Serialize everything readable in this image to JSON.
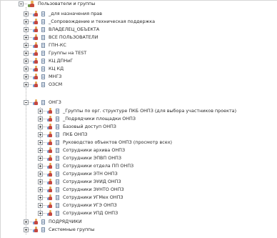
{
  "tree": {
    "root": {
      "label": "Пользователи и группы",
      "icon": "users-group-icon"
    },
    "groups": [
      {
        "label": "_для назначения прав"
      },
      {
        "label": "_Сопровождение и техническая поддержка"
      },
      {
        "label": "ВЛАДЕЛЕЦ_ОБЪЕКТА"
      },
      {
        "label": "ВСЕ ПОЛЬЗОВАТЕЛИ"
      },
      {
        "label": "ГПН-КС"
      },
      {
        "label": "Группы на TEST"
      },
      {
        "label": "КЦ ДПНиГ"
      },
      {
        "label": "КЦ КД"
      },
      {
        "label": "МНГЗ"
      },
      {
        "label": "ОЗСМ"
      },
      {
        "label": "ОНГЗ",
        "expanded": true
      },
      {
        "label": "ПОДРЯДЧИКИ"
      },
      {
        "label": "Системные группы"
      }
    ],
    "onhz_children": [
      {
        "label": "_Группы по орг. структуре ПКБ ОНПЗ (для выбора участников проекта)"
      },
      {
        "label": "_Подрядчики площадки ОНПЗ"
      },
      {
        "label": "Базовый доступ ОНПЗ"
      },
      {
        "label": "ПКБ ОНПЗ"
      },
      {
        "label": "Руководство объектов ОНПЗ (просмотр всех)"
      },
      {
        "label": "Сотрудники архива ОНПЗ"
      },
      {
        "label": "Сотрудники ЭПВП ОНПЗ"
      },
      {
        "label": "Сотрудники отдела ПП ОНПЗ"
      },
      {
        "label": "Сотрудники ЭТН ОНПЗ"
      },
      {
        "label": "Сотрудники ЭУИД ОНПЗ"
      },
      {
        "label": "Сотрудники ЭУНТО ОНПЗ"
      },
      {
        "label": "Сотрудники УГМех ОНПЗ"
      },
      {
        "label": "Сотрудники УГЭ ОНПЗ"
      },
      {
        "label": "Сотрудники УПД ОНПЗ"
      }
    ]
  }
}
